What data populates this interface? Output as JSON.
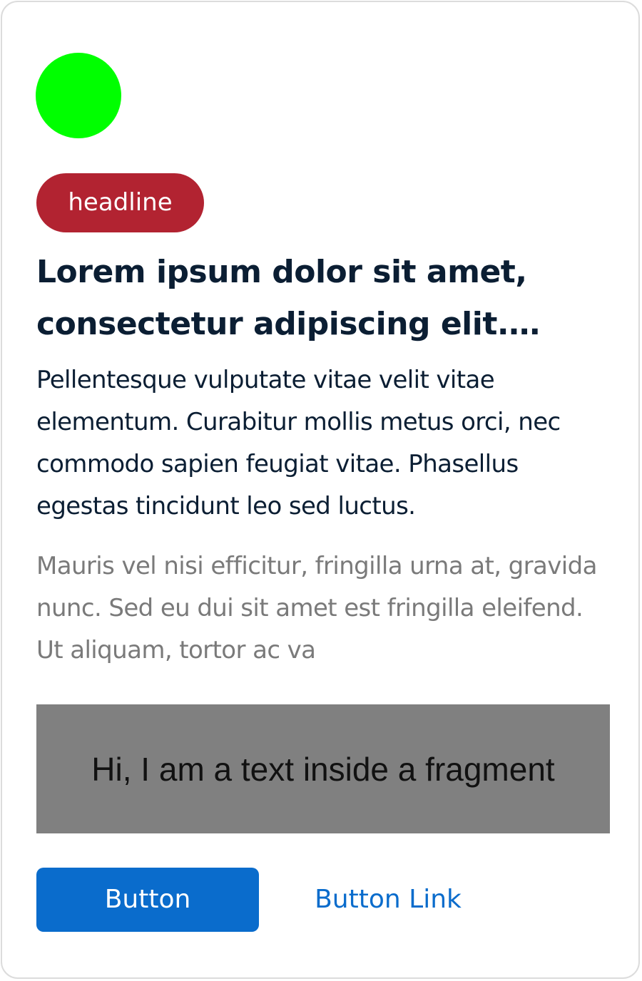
{
  "colors": {
    "avatar": "#00ff00",
    "tag_background": "#b22331",
    "primary_button": "#0a6ccc",
    "link": "#0a6ccc"
  },
  "card": {
    "tag": "headline",
    "title": "Lorem ipsum dolor sit amet, consectetur adipiscing elit. Morbi",
    "body": "Pellentesque vulputate vitae velit vitae elementum. Curabitur mollis metus orci, nec commodo sapien feugiat vitae. Phasellus egestas tincidunt leo sed luctus.",
    "secondary": "Mauris vel nisi efficitur, fringilla urna at, gravida nunc. Sed eu dui sit amet est fringilla eleifend. Ut aliquam, tortor ac va",
    "fragment_text": "Hi, I am a text inside a fragment",
    "primary_button_label": "Button",
    "link_button_label": "Button Link"
  }
}
